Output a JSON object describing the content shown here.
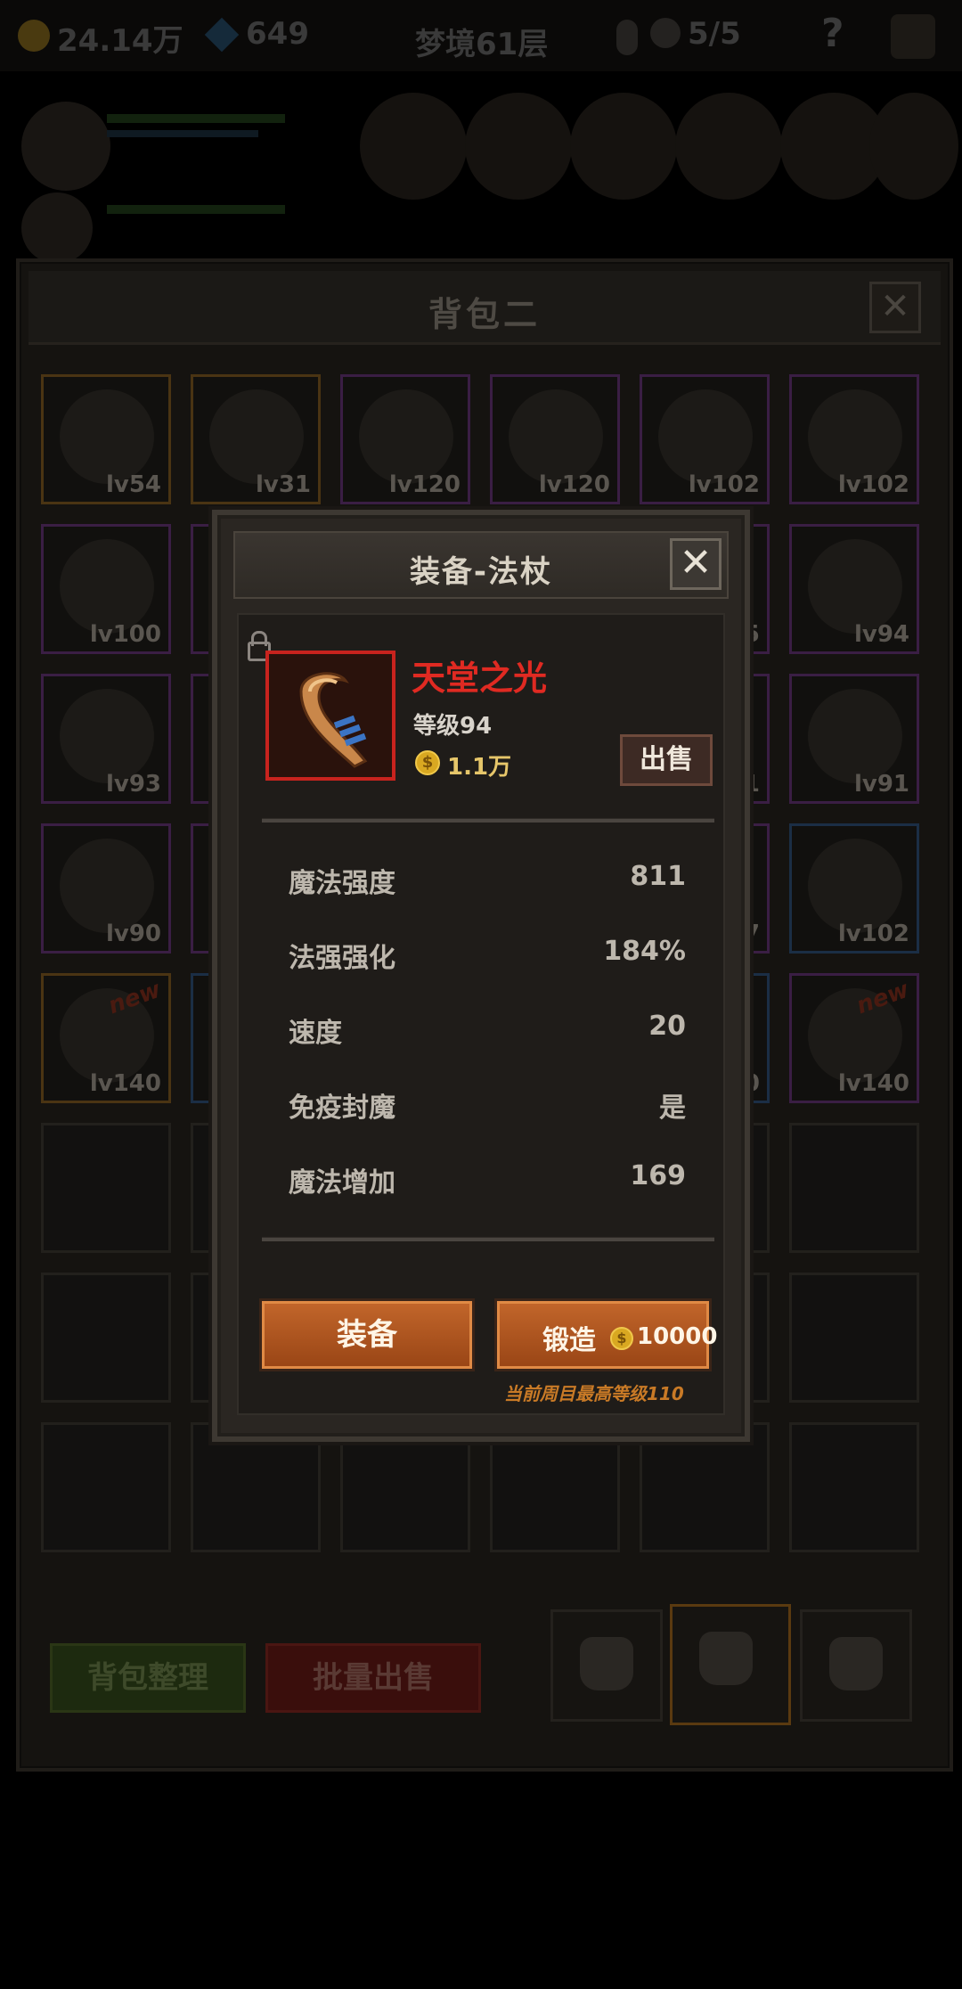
{
  "topbar": {
    "gold": "24.14万",
    "gems": "649",
    "dream_layer": "梦境61层",
    "skulls": "5/5",
    "help": "?"
  },
  "bag": {
    "title": "背包二",
    "close": "✕",
    "slots": [
      {
        "lv": "lv54",
        "rarity": "orange",
        "new": ""
      },
      {
        "lv": "lv31",
        "rarity": "orange",
        "new": ""
      },
      {
        "lv": "lv120",
        "rarity": "purple",
        "new": ""
      },
      {
        "lv": "lv120",
        "rarity": "purple",
        "new": ""
      },
      {
        "lv": "lv102",
        "rarity": "purple",
        "new": ""
      },
      {
        "lv": "lv102",
        "rarity": "purple",
        "new": ""
      },
      {
        "lv": "lv100",
        "rarity": "purple",
        "new": ""
      },
      {
        "lv": "",
        "rarity": "purple",
        "new": ""
      },
      {
        "lv": "",
        "rarity": "purple",
        "new": ""
      },
      {
        "lv": "",
        "rarity": "purple",
        "new": ""
      },
      {
        "lv": "5",
        "rarity": "purple",
        "new": ""
      },
      {
        "lv": "lv94",
        "rarity": "purple",
        "new": ""
      },
      {
        "lv": "lv93",
        "rarity": "purple",
        "new": ""
      },
      {
        "lv": "",
        "rarity": "purple",
        "new": ""
      },
      {
        "lv": "",
        "rarity": "purple",
        "new": ""
      },
      {
        "lv": "",
        "rarity": "purple",
        "new": ""
      },
      {
        "lv": "1",
        "rarity": "purple",
        "new": ""
      },
      {
        "lv": "lv91",
        "rarity": "purple",
        "new": ""
      },
      {
        "lv": "lv90",
        "rarity": "purple",
        "new": ""
      },
      {
        "lv": "",
        "rarity": "purple",
        "new": ""
      },
      {
        "lv": "",
        "rarity": "purple",
        "new": ""
      },
      {
        "lv": "",
        "rarity": "purple",
        "new": ""
      },
      {
        "lv": "7",
        "rarity": "purple",
        "new": ""
      },
      {
        "lv": "lv102",
        "rarity": "blue",
        "new": ""
      },
      {
        "lv": "lv140",
        "rarity": "orange",
        "new": "new"
      },
      {
        "lv": "",
        "rarity": "blue",
        "new": ""
      },
      {
        "lv": "",
        "rarity": "blue",
        "new": ""
      },
      {
        "lv": "",
        "rarity": "blue",
        "new": ""
      },
      {
        "lv": "0",
        "rarity": "blue",
        "new": ""
      },
      {
        "lv": "lv140",
        "rarity": "purple",
        "new": "new"
      }
    ],
    "sort_button": "背包整理",
    "bulk_sell_button": "批量出售"
  },
  "modal": {
    "title": "装备-法杖",
    "close": "✕",
    "item_name": "天堂之光",
    "item_level": "等级94",
    "coin_symbol": "$",
    "price": "1.1万",
    "sell_button": "出售",
    "stats": [
      {
        "name": "魔法强度",
        "value": "811"
      },
      {
        "name": "法强强化",
        "value": "184%"
      },
      {
        "name": "速度",
        "value": "20"
      },
      {
        "name": "免疫封魔",
        "value": "是"
      },
      {
        "name": "魔法增加",
        "value": "169"
      }
    ],
    "equip_button": "装备",
    "forge_button": "锻造",
    "forge_cost": "10000",
    "note": "当前周目最高等级110"
  },
  "colors": {
    "item_name": "#e02a22",
    "button_orange": "#b3581f",
    "note": "#c97a26"
  }
}
